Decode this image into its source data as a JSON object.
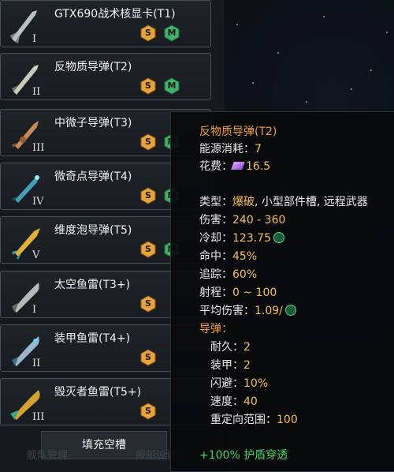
{
  "colors": {
    "accent": "#f2a03a",
    "value": "#f3c24e",
    "green": "#4bd36a",
    "badge_orange": "#e8a33a",
    "badge_green": "#3fb36a"
  },
  "items": [
    {
      "name": "GTX690战术核显卡(T1)",
      "tier": "I",
      "badges": [
        "S",
        "M"
      ]
    },
    {
      "name": "反物质导弹(T2)",
      "tier": "II",
      "badges": [
        "S",
        "M"
      ]
    },
    {
      "name": "中微子导弹(T3)",
      "tier": "III",
      "badges": [
        "S",
        "M"
      ]
    },
    {
      "name": "微奇点导弹(T4)",
      "tier": "IV",
      "badges": [
        "S",
        "M"
      ]
    },
    {
      "name": "维度泡导弹(T5)",
      "tier": "V",
      "badges": [
        "S",
        "M"
      ]
    },
    {
      "name": "太空鱼雷(T3+)",
      "tier": "I",
      "badges": [
        "S"
      ]
    },
    {
      "name": "装甲鱼雷(T4+)",
      "tier": "II",
      "badges": [
        "S"
      ]
    },
    {
      "name": "毁灭者鱼雷(T5+)",
      "tier": "III",
      "badges": [
        "S"
      ]
    }
  ],
  "fill_button": "填充空槽",
  "bottom_tabs": [
    "舰队管理",
    "舰船设计"
  ],
  "tooltip": {
    "title": "反物质导弹(T2)",
    "energy_label": "能源消耗：",
    "energy_value": "7",
    "cost_label": "花费：",
    "cost_value": "16.5",
    "type_label": "类型：",
    "type_value_1": "爆破",
    "type_value_2": ", 小型部件槽, 远程武器",
    "damage_label": "伤害：",
    "damage_value": "240 - 360",
    "cooldown_label": "冷却：",
    "cooldown_value": "123.75",
    "accuracy_label": "命中：",
    "accuracy_value": "45%",
    "tracking_label": "追踪：",
    "tracking_value": "60%",
    "range_label": "射程：",
    "range_value": "0 ~ 100",
    "avg_label": "平均伤害：",
    "avg_value": "1.09/",
    "missile_label": "导弹：",
    "hp_label": "耐久：",
    "hp_value": "2",
    "armor_label": "装甲：",
    "armor_value": "2",
    "evasion_label": "闪避：",
    "evasion_value": "10%",
    "speed_label": "速度：",
    "speed_value": "40",
    "retarget_label": "重定向范围：",
    "retarget_value": "100",
    "shield_pen": "+100% 护盾穿透"
  }
}
